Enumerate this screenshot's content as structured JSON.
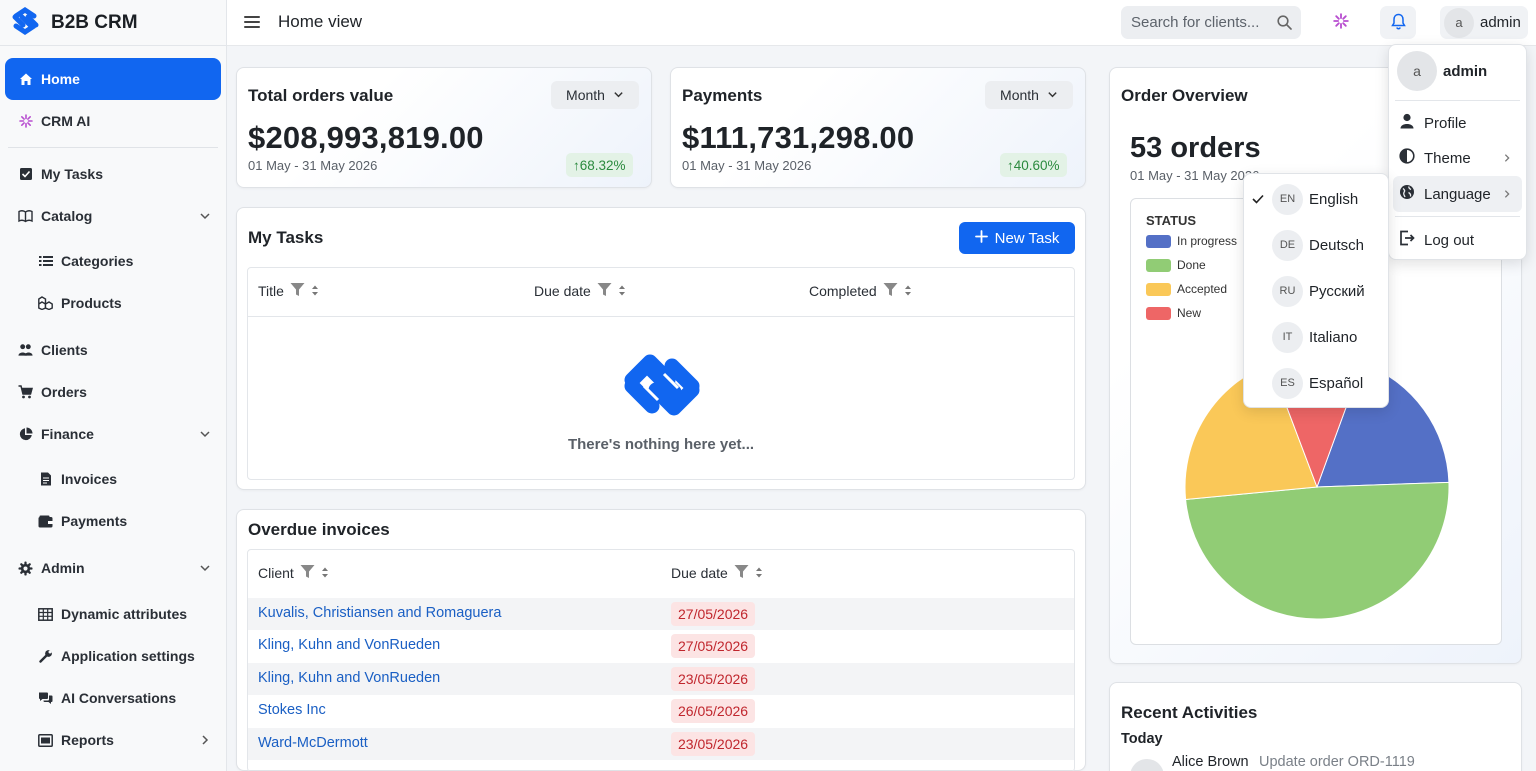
{
  "app": {
    "name": "B2B CRM",
    "brand_color": "#1166f0"
  },
  "sidebar": {
    "items": [
      {
        "label": "Home",
        "icon": "home-icon",
        "active": true
      },
      {
        "label": "CRM AI",
        "icon": "sparkle-icon"
      },
      {
        "label": "My Tasks",
        "icon": "checkbox-icon"
      },
      {
        "label": "Catalog",
        "icon": "book-icon",
        "expandable": true
      },
      {
        "label": "Categories",
        "icon": "list-icon"
      },
      {
        "label": "Products",
        "icon": "boxes-icon"
      },
      {
        "label": "Clients",
        "icon": "people-icon"
      },
      {
        "label": "Orders",
        "icon": "cart-icon"
      },
      {
        "label": "Finance",
        "icon": "pie-icon",
        "expandable": true
      },
      {
        "label": "Invoices",
        "icon": "document-icon"
      },
      {
        "label": "Payments",
        "icon": "wallet-icon"
      },
      {
        "label": "Admin",
        "icon": "gear-icon",
        "expandable": true
      },
      {
        "label": "Dynamic attributes",
        "icon": "table-icon"
      },
      {
        "label": "Application settings",
        "icon": "wrench-icon"
      },
      {
        "label": "AI Conversations",
        "icon": "chat-icon"
      },
      {
        "label": "Reports",
        "icon": "report-icon",
        "expandable": true
      }
    ]
  },
  "header": {
    "title": "Home view",
    "search_placeholder": "Search for clients...",
    "user_initial": "a",
    "user_name": "admin"
  },
  "total_orders": {
    "title": "Total orders value",
    "period": "Month",
    "value": "$208,993,819.00",
    "date_range": "01 May - 31 May 2026",
    "trend": "↑68.32%"
  },
  "payments": {
    "title": "Payments",
    "period": "Month",
    "value": "$111,731,298.00",
    "date_range": "01 May - 31 May 2026",
    "trend": "↑40.60%"
  },
  "tasks": {
    "title": "My Tasks",
    "new_task_label": "New Task",
    "columns": [
      "Title",
      "Due date",
      "Completed"
    ],
    "empty_text": "There's nothing here yet..."
  },
  "invoices": {
    "title": "Overdue invoices",
    "columns": [
      "Client",
      "Due date"
    ],
    "rows": [
      {
        "client": "Kuvalis, Christiansen and Romaguera",
        "due": "27/05/2026"
      },
      {
        "client": "Kling, Kuhn and VonRueden",
        "due": "27/05/2026"
      },
      {
        "client": "Kling, Kuhn and VonRueden",
        "due": "23/05/2026"
      },
      {
        "client": "Stokes Inc",
        "due": "26/05/2026"
      },
      {
        "client": "Ward-McDermott",
        "due": "23/05/2026"
      }
    ]
  },
  "order_overview": {
    "title": "Order Overview",
    "count": "53 orders",
    "date_range": "01 May - 31 May 2026",
    "status_title": "STATUS",
    "legend": [
      {
        "label": "In progress",
        "color": "#5470c6"
      },
      {
        "label": "Done",
        "color": "#91cc75"
      },
      {
        "label": "Accepted",
        "color": "#fac858"
      },
      {
        "label": "New",
        "color": "#ee6666"
      }
    ]
  },
  "chart_data": {
    "type": "pie",
    "title": "STATUS",
    "categories": [
      "In progress",
      "Done",
      "Accepted",
      "New"
    ],
    "values": [
      10,
      26,
      11,
      6
    ],
    "colors": [
      "#5470c6",
      "#91cc75",
      "#fac858",
      "#ee6666"
    ]
  },
  "user_menu": {
    "user_initial": "a",
    "user_name": "admin",
    "items": [
      {
        "label": "Profile",
        "icon": "person-icon"
      },
      {
        "label": "Theme",
        "icon": "contrast-icon",
        "submenu": true
      },
      {
        "label": "Language",
        "icon": "globe-icon",
        "submenu": true
      },
      {
        "label": "Log out",
        "icon": "logout-icon"
      }
    ]
  },
  "language_menu": {
    "items": [
      {
        "code": "EN",
        "label": "English",
        "selected": true
      },
      {
        "code": "DE",
        "label": "Deutsch"
      },
      {
        "code": "RU",
        "label": "Русский"
      },
      {
        "code": "IT",
        "label": "Italiano"
      },
      {
        "code": "ES",
        "label": "Español"
      }
    ]
  },
  "recent_activities": {
    "title": "Recent Activities",
    "day": "Today",
    "entries": [
      {
        "user": "Alice Brown",
        "text": "Update order ORD-1119"
      }
    ]
  }
}
